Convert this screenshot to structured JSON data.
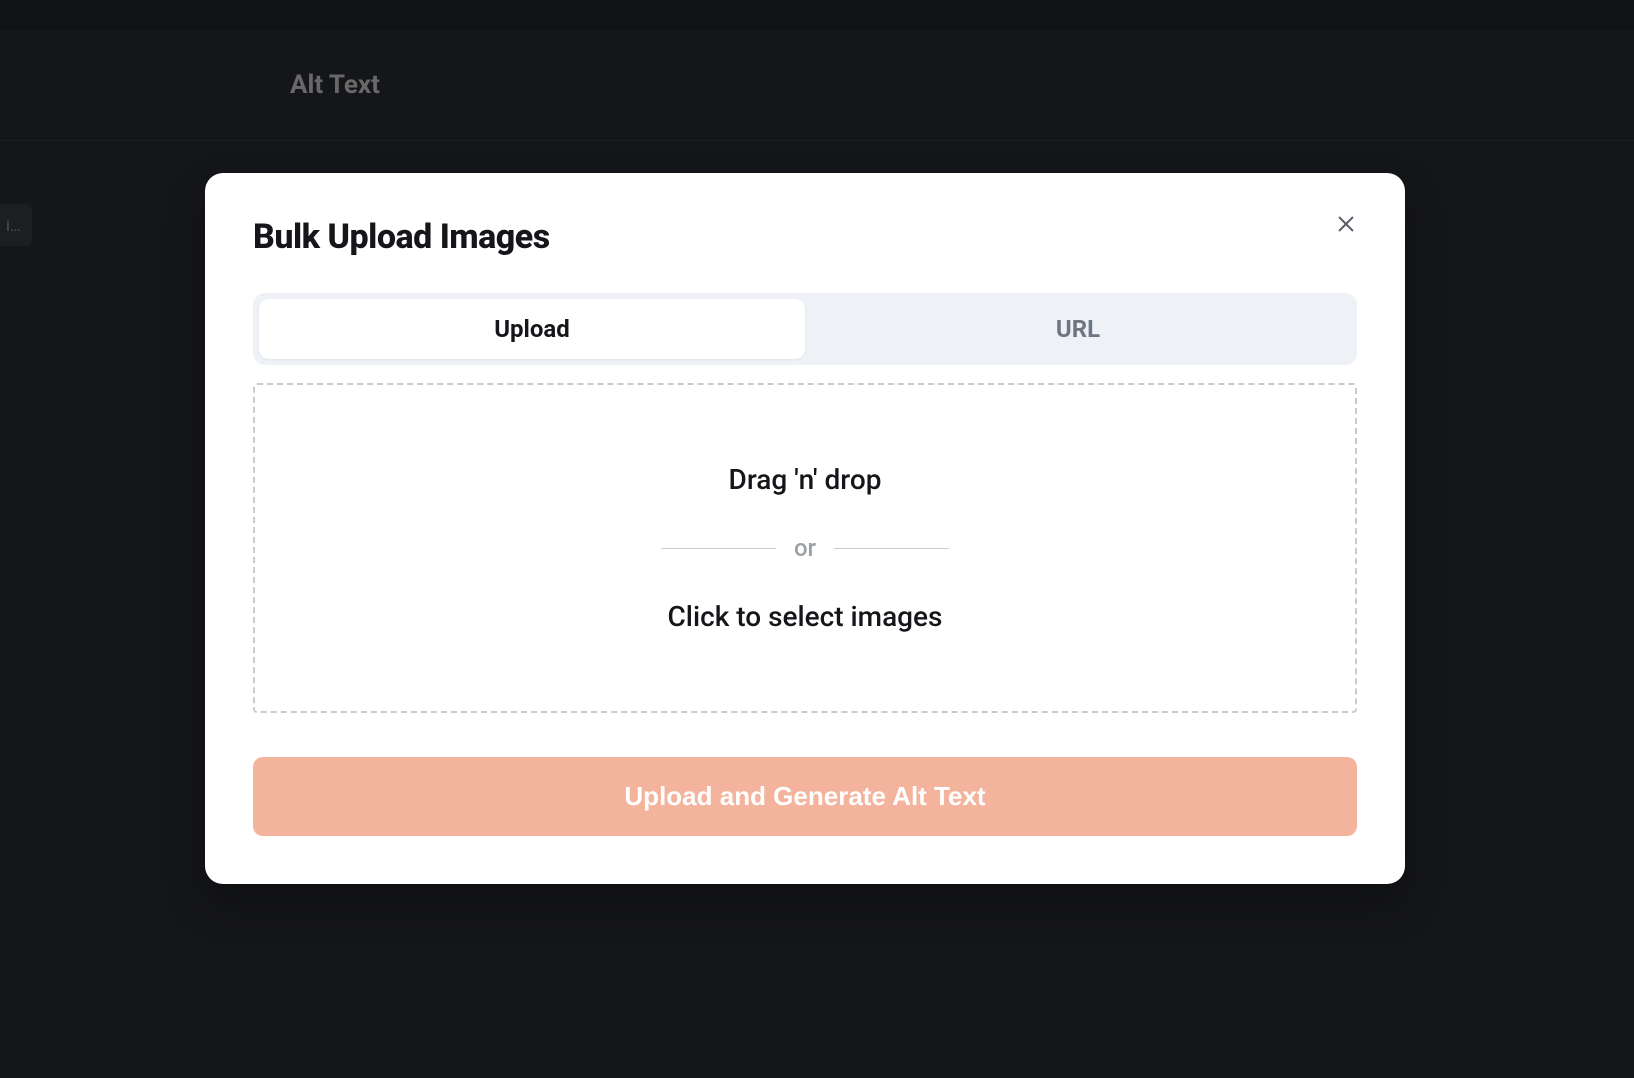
{
  "background": {
    "page_title": "Alt Text",
    "sidebar_truncated": "i…"
  },
  "modal": {
    "title": "Bulk Upload Images",
    "tabs": {
      "upload": "Upload",
      "url": "URL"
    },
    "dropzone": {
      "line1": "Drag 'n' drop",
      "divider": "or",
      "line2": "Click to select images"
    },
    "submit_label": "Upload and Generate Alt Text"
  }
}
